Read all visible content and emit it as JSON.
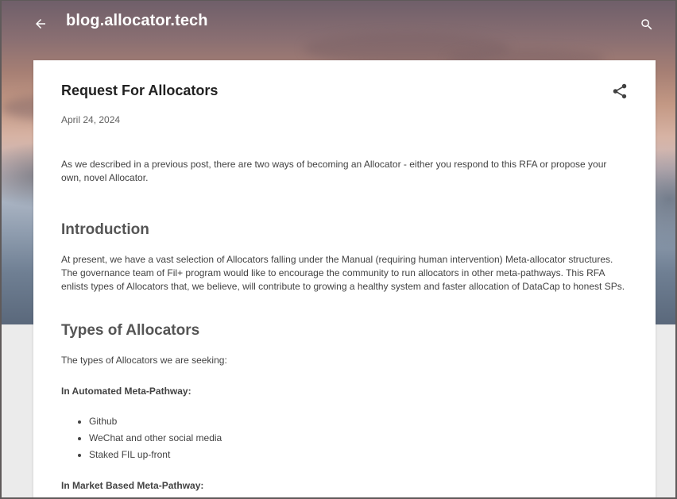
{
  "header": {
    "site_title": "blog.allocator.tech",
    "back_icon": "arrow-left-icon",
    "search_icon": "search-icon"
  },
  "post": {
    "title": "Request For Allocators",
    "date": "April 24, 2024",
    "share_icon": "share-icon",
    "intro_paragraph": "As we described in a previous post, there are two ways of becoming an Allocator - either you respond to this RFA or propose your own, novel Allocator.",
    "sections": {
      "introduction": {
        "heading": "Introduction",
        "paragraph": "At present, we have a vast selection of Allocators falling under the Manual (requiring human intervention) Meta-allocator structures. The governance team of Fil+ program would like to encourage the community to run allocators in other meta-pathways. This RFA enlists types of Allocators that, we believe, will contribute to growing a healthy system and faster allocation of DataCap to honest SPs."
      },
      "types": {
        "heading": "Types of Allocators",
        "paragraph": "The types of Allocators we are seeking:",
        "automated_label": "In Automated Meta-Pathway:",
        "automated_items": [
          "Github",
          "WeChat and other social media",
          "Staked FIL up-front"
        ],
        "market_label": "In Market Based Meta-Pathway:"
      }
    }
  },
  "colors": {
    "header_text": "#ffffff",
    "title_text": "#212121",
    "heading_text": "#555555",
    "body_text": "#424242",
    "page_background": "#ebebeb"
  }
}
